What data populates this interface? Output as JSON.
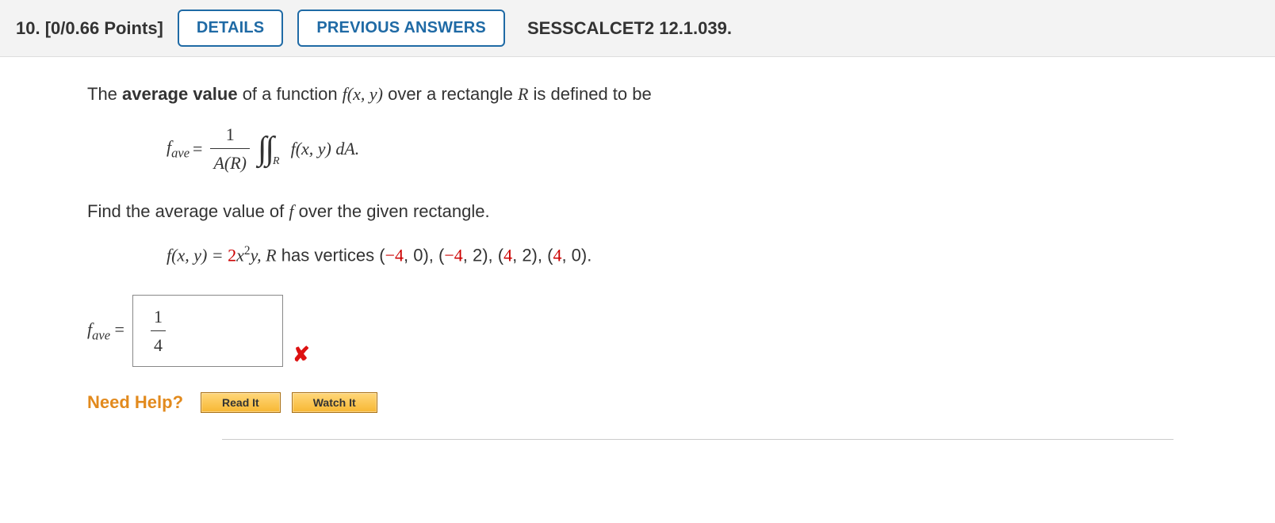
{
  "header": {
    "qnum": "10.",
    "points": "[0/0.66 Points]",
    "details_btn": "DETAILS",
    "prev_btn": "PREVIOUS ANSWERS",
    "source": "SESSCALCET2 12.1.039."
  },
  "body": {
    "intro_pre": "The ",
    "intro_bold": "average value",
    "intro_post1": " of a function  ",
    "fxy": "f(x, y)",
    "intro_post2": "  over a rectangle ",
    "R": "R",
    "intro_post3": " is defined to be",
    "formula": {
      "fave": "f",
      "ave": "ave",
      "eq": " = ",
      "num1": "1",
      "denAR": "A(R)",
      "Rsub": "R",
      "integrand": " f(x, y) dA."
    },
    "prompt2a": "Find the average value of ",
    "prompt2f": "f",
    "prompt2b": " over the given rectangle.",
    "fxy_eq": "f(x, y) = ",
    "coeff2": "2",
    "x": "x",
    "sq": "2",
    "y": "y",
    "rect_text": ", R has vertices (",
    "v1a": "−4",
    "c1": ", 0), (",
    "v2a": "−4",
    "c2": ", 2), (",
    "v3a": "4",
    "c3": ", 2), (",
    "v4a": "4",
    "c4": ", 0).",
    "answer": {
      "label_f": "f",
      "label_ave": "ave",
      "label_eq": " = ",
      "num": "1",
      "den": "4"
    },
    "wrong": "✘",
    "help": {
      "label": "Need Help?",
      "read": "Read It",
      "watch": "Watch It"
    }
  }
}
